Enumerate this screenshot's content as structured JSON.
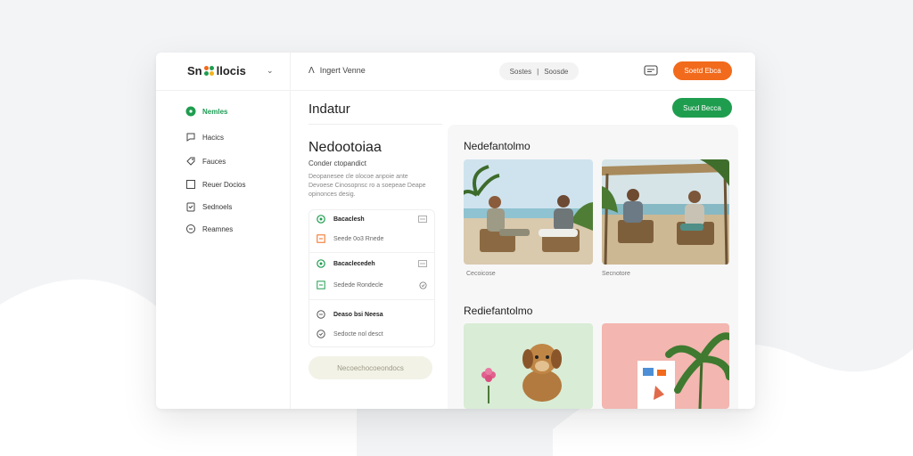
{
  "brand": {
    "name_left": "Sn",
    "name_right": "llocis"
  },
  "header": {
    "breadcrumb": "Ingert Venne",
    "pill_left": "Sostes",
    "pill_sep": "|",
    "pill_right": "Soosde",
    "cta_label": "Soetd Ebca"
  },
  "sidebar": {
    "items": [
      {
        "label": "Nemles"
      },
      {
        "label": "Hacics"
      },
      {
        "label": "Fauces"
      },
      {
        "label": "Reuer Docios"
      },
      {
        "label": "Sednoels"
      },
      {
        "label": "Reamnes"
      }
    ]
  },
  "main": {
    "title": "Indatur",
    "primary_button": "Sucd Becca"
  },
  "left_panel": {
    "title": "Nedootoiaa",
    "subtitle": "Conder ctopandict",
    "description": "Deopanesee cle olocoe anpoie ante Devoese Cinosopnsc ro a soepeae Deape opinonces desig.",
    "rows": [
      {
        "text": "Bacaclesh"
      },
      {
        "text": "Seede 0o3 Rnede"
      },
      {
        "text": "Bacaclecedeh"
      },
      {
        "text": "Sedede Rondecle"
      },
      {
        "text": "Deaso bsi Neesa"
      },
      {
        "text": "Sedocte nol desct"
      }
    ],
    "ghost_button": "Necoechocoeondocs"
  },
  "gallery": {
    "section1_title": "Nedefantolmo",
    "section2_title": "Rediefantolmo",
    "photo1_caption": "Cecoicose",
    "photo2_caption": "Secnotore"
  },
  "colors": {
    "green": "#1f9d4f",
    "orange": "#f26a1b",
    "card_bg": "#ffffff",
    "page_bg": "#f3f4f6"
  },
  "icons": [
    "brand-logo-icon",
    "chevron-down-icon",
    "bell-icon",
    "circle-dot-icon",
    "chat-icon",
    "tag-icon",
    "square-icon",
    "clipboard-icon",
    "circle-icon",
    "shield-icon"
  ]
}
